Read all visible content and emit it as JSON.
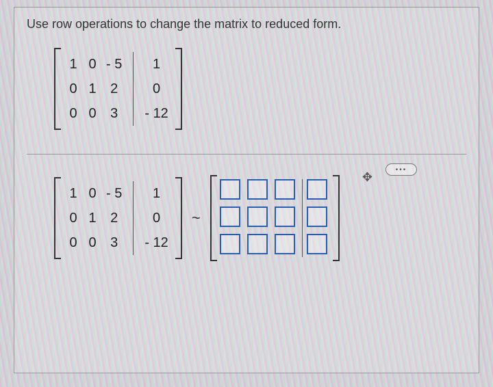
{
  "prompt": "Use row operations to change the matrix to reduced form.",
  "matrix_top": {
    "left": [
      [
        "1",
        "0",
        "- 5"
      ],
      [
        "0",
        "1",
        "2"
      ],
      [
        "0",
        "0",
        "3"
      ]
    ],
    "right": [
      [
        "1"
      ],
      [
        "0"
      ],
      [
        "- 12"
      ]
    ]
  },
  "matrix_bottom_left": {
    "left": [
      [
        "1",
        "0",
        "- 5"
      ],
      [
        "0",
        "1",
        "2"
      ],
      [
        "0",
        "0",
        "3"
      ]
    ],
    "right": [
      [
        "1"
      ],
      [
        "0"
      ],
      [
        "- 12"
      ]
    ]
  },
  "tilde": "~",
  "answer_grid": {
    "rows": 3,
    "cols": 4
  },
  "more_label": "•••",
  "move_icon": "✥"
}
